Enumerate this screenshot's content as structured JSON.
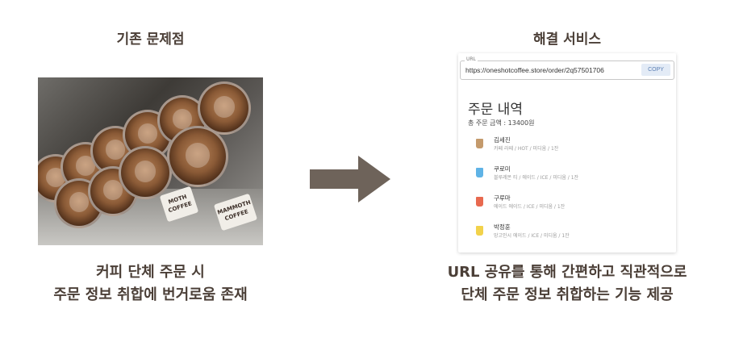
{
  "left": {
    "heading": "기존 문제점",
    "caption_line1": "커피 단체 주문 시",
    "caption_line2": "주문 정보 취합에 번거로움 존재",
    "photo_sticker_1": "MAMMOTH COFFEE",
    "photo_sticker_2": "MOTH COFFEE"
  },
  "right": {
    "heading": "해결 서비스",
    "caption_line1": "URL 공유를 통해 간편하고 직관적으로",
    "caption_line2": "단체 주문 정보 취합하는 기능 제공"
  },
  "app": {
    "url_label": "URL",
    "url_value": "https://oneshotcoffee.store/order/2q57501706",
    "copy_label": "COPY",
    "title": "주문 내역",
    "total": "총 주문 금액 : 13400원",
    "items": [
      {
        "name": "김세진",
        "options": "카페 라떼 / HOT / 미디움 / 1잔",
        "icon": "latte-cup-icon",
        "color": "#c49a6c"
      },
      {
        "name": "쿠로미",
        "options": "블루레몬 티 / 에이드 / ICE / 미디움 / 1잔",
        "icon": "blue-ade-cup-icon",
        "color": "#5fb3e6"
      },
      {
        "name": "구루마",
        "options": "에이드 에이드 / ICE / 미디움 / 1잔",
        "icon": "red-ade-cup-icon",
        "color": "#e8694f"
      },
      {
        "name": "박정훈",
        "options": "망고인시 에이드 / ICE / 미디움 / 1잔",
        "icon": "yellow-ade-cup-icon",
        "color": "#f2d24b"
      }
    ]
  },
  "colors": {
    "text": "#4b3f37",
    "arrow": "#6e635a",
    "copy_button_bg": "#e3ebf6"
  }
}
